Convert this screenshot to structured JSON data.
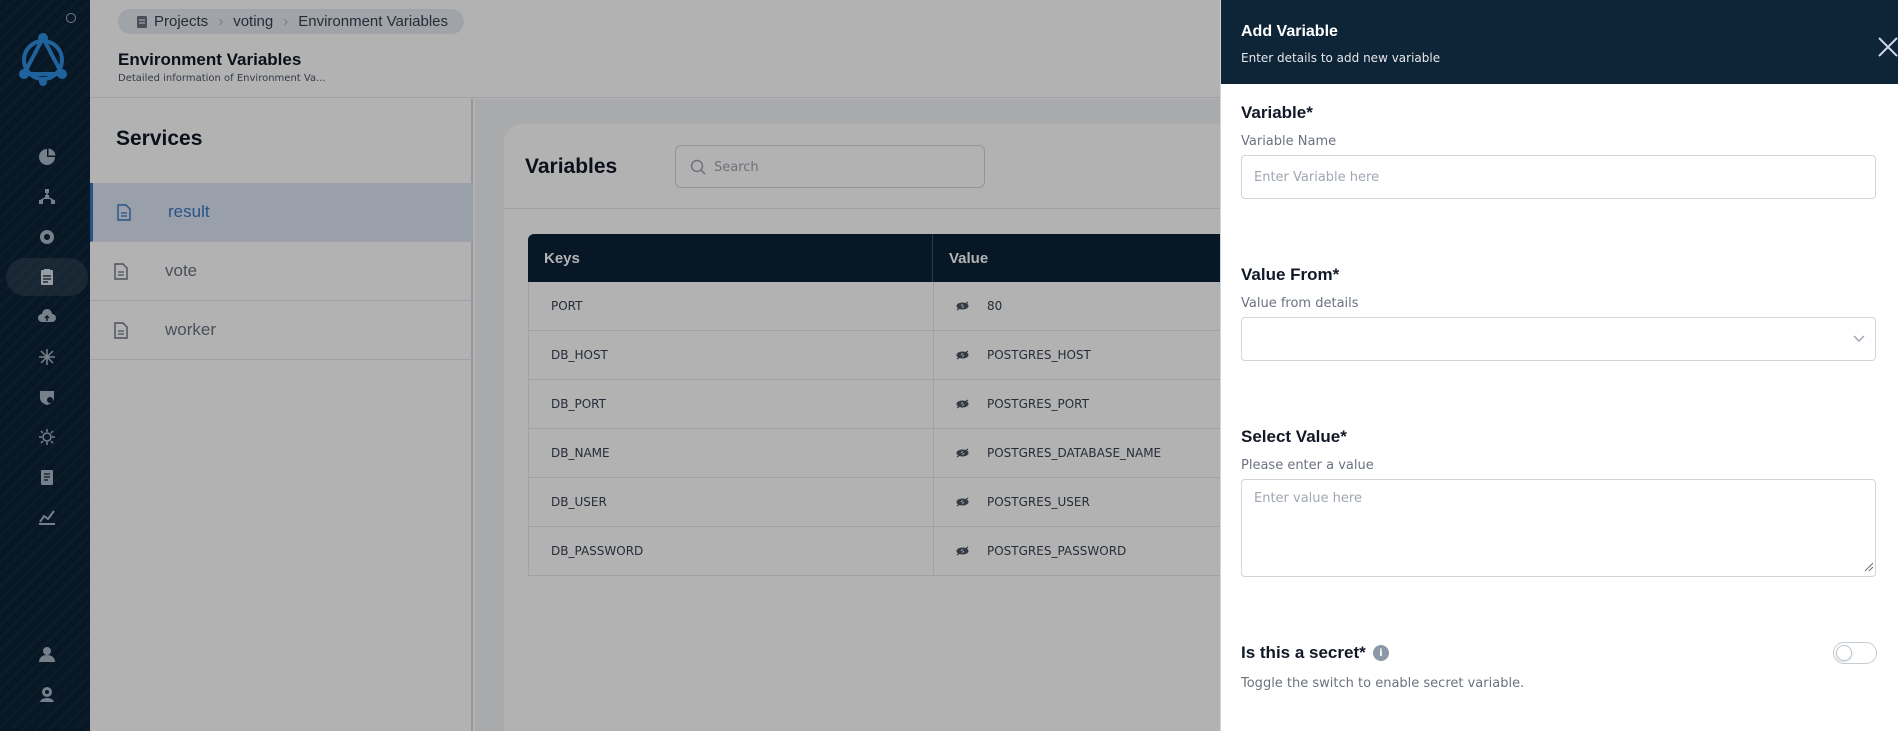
{
  "breadcrumb": {
    "items": [
      "Projects",
      "voting",
      "Environment Variables"
    ]
  },
  "header": {
    "title": "Environment Variables",
    "subtitle": "Detailed information of Environment Va..."
  },
  "services": {
    "title": "Services",
    "items": [
      {
        "label": "result",
        "active": true
      },
      {
        "label": "vote",
        "active": false
      },
      {
        "label": "worker",
        "active": false
      }
    ]
  },
  "variables": {
    "title": "Variables",
    "search_placeholder": "Search",
    "columns": {
      "key": "Keys",
      "value": "Value"
    },
    "rows": [
      {
        "key": "PORT",
        "value": "80"
      },
      {
        "key": "DB_HOST",
        "value": "POSTGRES_HOST"
      },
      {
        "key": "DB_PORT",
        "value": "POSTGRES_PORT"
      },
      {
        "key": "DB_NAME",
        "value": "POSTGRES_DATABASE_NAME"
      },
      {
        "key": "DB_USER",
        "value": "POSTGRES_USER"
      },
      {
        "key": "DB_PASSWORD",
        "value": "POSTGRES_PASSWORD"
      }
    ]
  },
  "drawer": {
    "title": "Add Variable",
    "subtitle": "Enter details to add new variable",
    "variable": {
      "label": "Variable*",
      "hint": "Variable Name",
      "placeholder": "Enter Variable here",
      "value": ""
    },
    "value_from": {
      "label": "Value From*",
      "hint": "Value from details",
      "selected": ""
    },
    "select_value": {
      "label": "Select Value*",
      "hint": "Please enter a value",
      "placeholder": "Enter value here",
      "value": ""
    },
    "secret": {
      "label": "Is this a secret*",
      "info_icon": "i",
      "hint": "Toggle the switch to enable secret variable.",
      "enabled": false
    }
  },
  "colors": {
    "rail": "#0b2235",
    "drawer_header": "#0e2538",
    "accent": "#3a77c2",
    "table_header": "#0b2235"
  },
  "icons": {
    "rail": [
      "dashboard-icon",
      "network-icon",
      "settings-gear-icon",
      "environment-icon",
      "cloud-upload-icon",
      "cluster-icon",
      "security-shield-icon",
      "health-icon",
      "docs-icon",
      "monitoring-icon",
      "user-icon",
      "team-settings-icon"
    ]
  }
}
